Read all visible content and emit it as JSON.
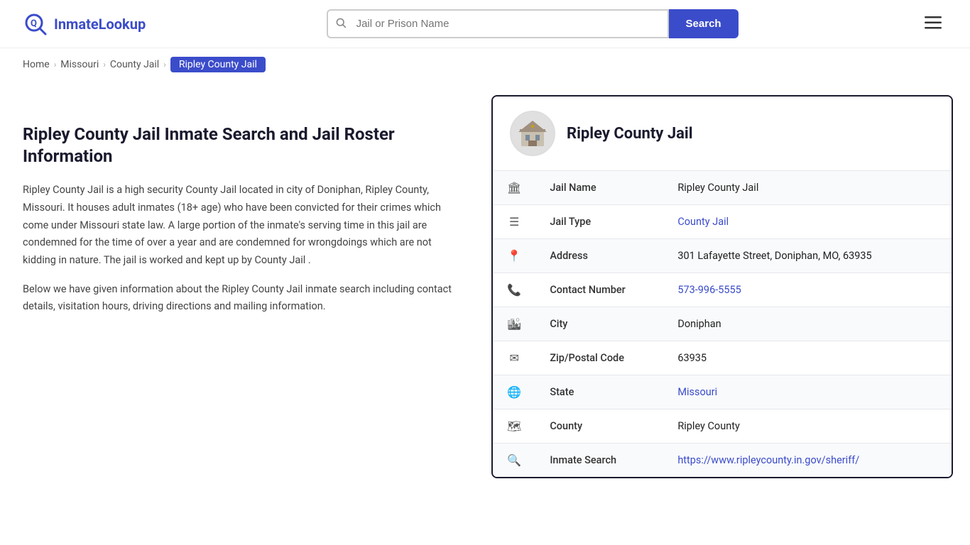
{
  "header": {
    "logo_text_1": "Inmate",
    "logo_text_2": "Lookup",
    "search_placeholder": "Jail or Prison Name",
    "search_button_label": "Search"
  },
  "breadcrumb": {
    "home": "Home",
    "state": "Missouri",
    "type": "County Jail",
    "current": "Ripley County Jail"
  },
  "left": {
    "title": "Ripley County Jail Inmate Search and Jail Roster Information",
    "para1": "Ripley County Jail is a high security County Jail located in city of Doniphan, Ripley County, Missouri. It houses adult inmates (18+ age) who have been convicted for their crimes which come under Missouri state law. A large portion of the inmate's serving time in this jail are condemned for the time of over a year and are condemned for wrongdoings which are not kidding in nature. The jail is worked and kept up by County Jail .",
    "para2": "Below we have given information about the Ripley County Jail inmate search including contact details, visitation hours, driving directions and mailing information."
  },
  "card": {
    "title": "Ripley County Jail",
    "rows": [
      {
        "icon": "🏛",
        "label": "Jail Name",
        "value": "Ripley County Jail",
        "link": null
      },
      {
        "icon": "☰",
        "label": "Jail Type",
        "value": "County Jail",
        "link": "#"
      },
      {
        "icon": "📍",
        "label": "Address",
        "value": "301 Lafayette Street, Doniphan, MO, 63935",
        "link": null
      },
      {
        "icon": "📞",
        "label": "Contact Number",
        "value": "573-996-5555",
        "link": "tel:5739965555"
      },
      {
        "icon": "🏙",
        "label": "City",
        "value": "Doniphan",
        "link": null
      },
      {
        "icon": "✉",
        "label": "Zip/Postal Code",
        "value": "63935",
        "link": null
      },
      {
        "icon": "🌐",
        "label": "State",
        "value": "Missouri",
        "link": "#"
      },
      {
        "icon": "🗺",
        "label": "County",
        "value": "Ripley County",
        "link": null
      },
      {
        "icon": "🔍",
        "label": "Inmate Search",
        "value": "https://www.ripleycounty.in.gov/sheriff/",
        "link": "https://www.ripleycounty.in.gov/sheriff/"
      }
    ]
  },
  "colors": {
    "accent": "#3b4cca",
    "dark": "#1a1a2e"
  }
}
